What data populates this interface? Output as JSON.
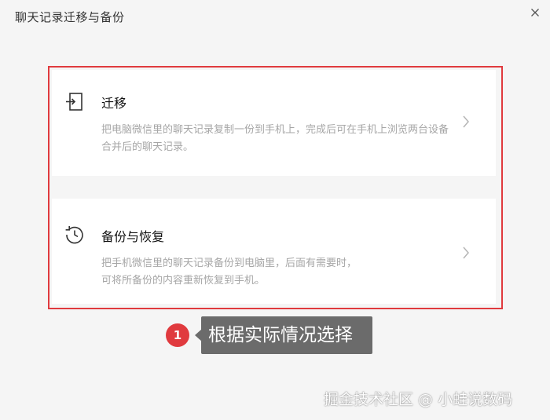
{
  "dialog": {
    "title": "聊天记录迁移与备份",
    "close_icon": "close-icon"
  },
  "options": [
    {
      "icon": "migrate-icon",
      "title": "迁移",
      "description": "把电脑微信里的聊天记录复制一份到手机上，完成后可在手机上浏览两台设备合并后的聊天记录。"
    },
    {
      "icon": "backup-restore-icon",
      "title": "备份与恢复",
      "description_line1": "把手机微信里的聊天记录备份到电脑里，后面有需要时，",
      "description_line2": "可将所备份的内容重新恢复到手机。"
    }
  ],
  "annotation": {
    "step_number": "1",
    "text": "根据实际情况选择",
    "color": "#e03a3e"
  },
  "watermark": "掘金技术社区 @ 小蛙说数码"
}
